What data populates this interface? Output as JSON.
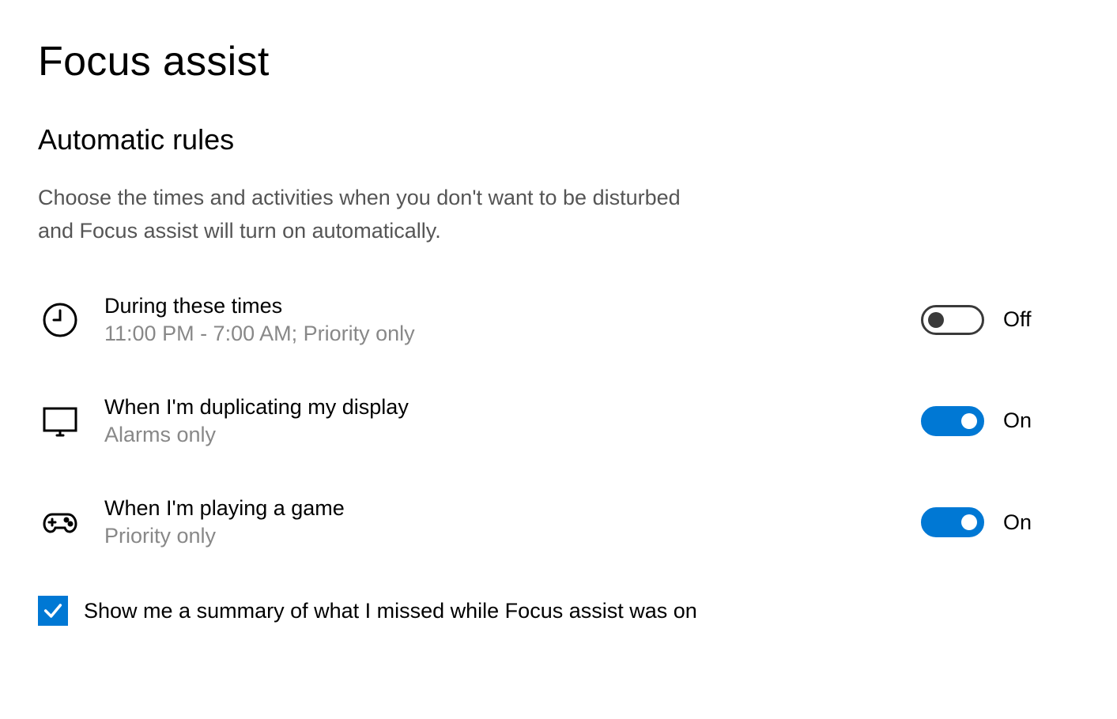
{
  "page": {
    "title": "Focus assist",
    "section_heading": "Automatic rules",
    "section_description": "Choose the times and activities when you don't want to be disturbed and Focus assist will turn on automatically."
  },
  "rules": [
    {
      "icon": "clock-icon",
      "title": "During these times",
      "subtitle": "11:00 PM - 7:00 AM; Priority only",
      "toggle_state": "off",
      "toggle_label": "Off"
    },
    {
      "icon": "monitor-icon",
      "title": "When I'm duplicating my display",
      "subtitle": "Alarms only",
      "toggle_state": "on",
      "toggle_label": "On"
    },
    {
      "icon": "gamepad-icon",
      "title": "When I'm playing a game",
      "subtitle": "Priority only",
      "toggle_state": "on",
      "toggle_label": "On"
    }
  ],
  "summary_checkbox": {
    "checked": true,
    "label": "Show me a summary of what I missed while Focus assist was on"
  },
  "colors": {
    "accent": "#0078d4",
    "text": "#000000",
    "muted": "#888888"
  }
}
